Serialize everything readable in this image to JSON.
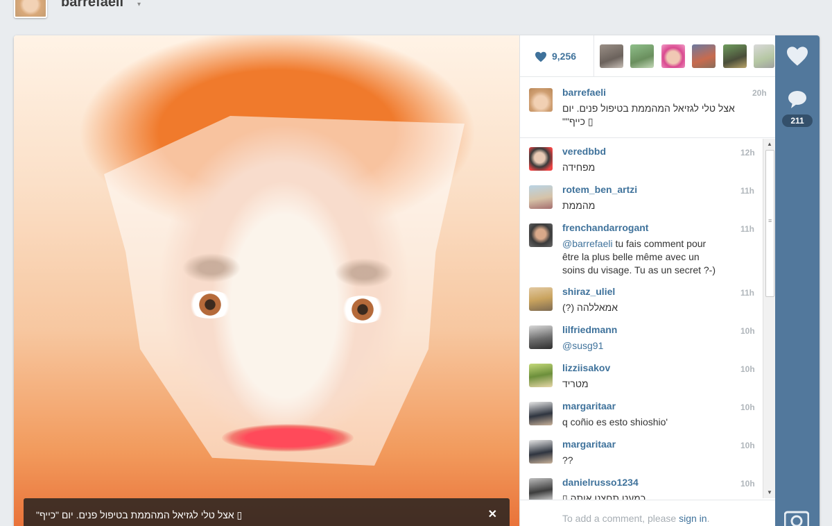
{
  "header": {
    "username": "barrefaeli",
    "caret": "▾"
  },
  "photo": {
    "caption": "\"אצל טלי לגזיאל המהממת בטיפול פנים. יום \"כייף ▯",
    "close_label": "✕"
  },
  "likes": {
    "count": "9,256"
  },
  "owner_post": {
    "username": "barrefaeli",
    "time": "20h",
    "text_line1": "אצל טלי לגזיאל המהממת בטיפול פנים. יום",
    "text_line2": "\"\"כייף ▯"
  },
  "comments": [
    {
      "username": "veredbbd",
      "time": "12h",
      "text": "מפחידה"
    },
    {
      "username": "rotem_ben_artzi",
      "time": "11h",
      "text": "מהממת"
    },
    {
      "username": "frenchandarrogant",
      "time": "11h",
      "mention": "@barrefaeli",
      "text_line1": " tu fais comment pour",
      "text_line2": "être la plus belle même avec un",
      "text_line3": "soins du visage. Tu as un secret ?-)"
    },
    {
      "username": "shiraz_uliel",
      "time": "11h",
      "text": "(?) אמאללהה"
    },
    {
      "username": "lilfriedmann",
      "time": "10h",
      "mention": "@susg91"
    },
    {
      "username": "lizziisakov",
      "time": "10h",
      "text": "מטריד"
    },
    {
      "username": "margaritaar",
      "time": "10h",
      "text": "q coñio es esto shioshio'"
    },
    {
      "username": "margaritaar",
      "time": "10h",
      "text": "??"
    },
    {
      "username": "danielrusso1234",
      "time": "10h",
      "text": "▯ כמעט תחצנו אותה"
    }
  ],
  "add_comment": {
    "prefix": "To add a comment, please ",
    "link": "sign in",
    "suffix": "."
  },
  "rail": {
    "comment_count": "211"
  },
  "colors": {
    "link": "#3f729b",
    "rail": "#52789c",
    "badge": "#34506b"
  }
}
